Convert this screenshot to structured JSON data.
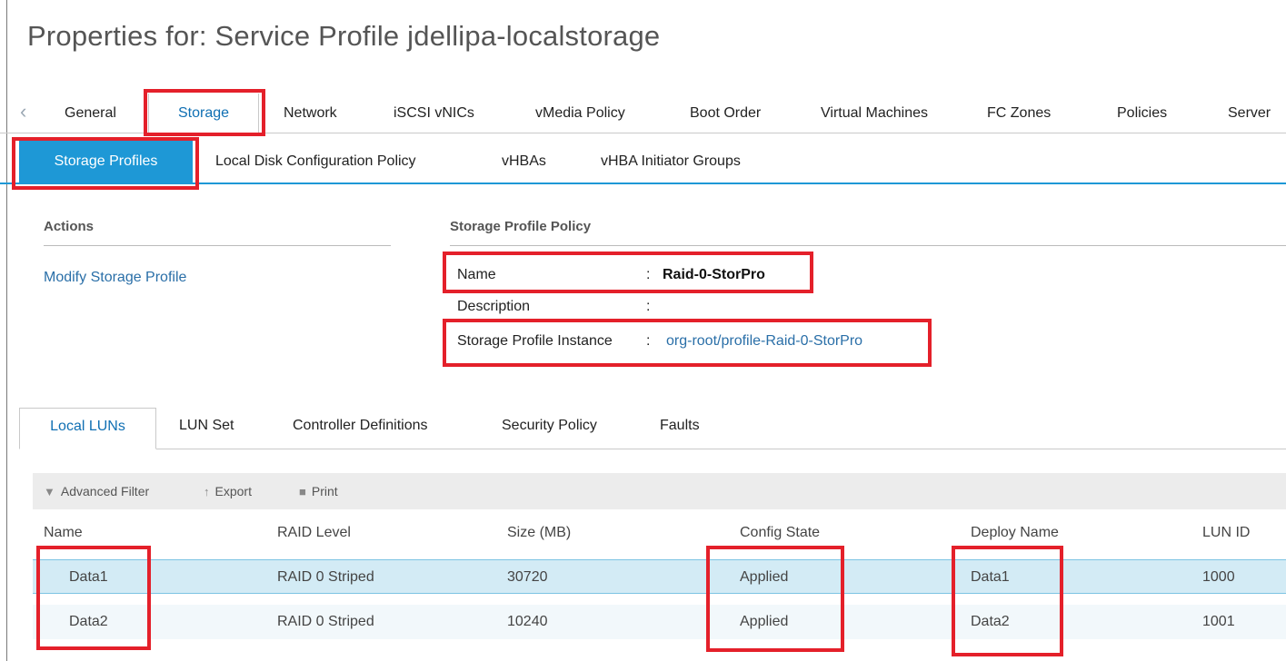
{
  "header": {
    "title": "Properties for: Service Profile jdellipa-localstorage"
  },
  "top_tabs": [
    "General",
    "Storage",
    "Network",
    "iSCSI vNICs",
    "vMedia Policy",
    "Boot Order",
    "Virtual Machines",
    "FC Zones",
    "Policies",
    "Server"
  ],
  "top_tab_scroll_glyph": "‹",
  "sub_tabs": [
    "Storage Profiles",
    "Local Disk Configuration Policy",
    "vHBAs",
    "vHBA Initiator Groups"
  ],
  "actions": {
    "heading": "Actions",
    "modify_link": "Modify Storage Profile"
  },
  "policy": {
    "heading": "Storage Profile Policy",
    "name_label": "Name",
    "name_value": "Raid-0-StorPro",
    "description_label": "Description",
    "description_value": "",
    "instance_label": "Storage Profile Instance",
    "instance_value": "org-root/profile-Raid-0-StorPro",
    "separator": ":"
  },
  "bottom_tabs": [
    "Local LUNs",
    "LUN Set",
    "Controller Definitions",
    "Security Policy",
    "Faults"
  ],
  "toolbar": {
    "filter": "Advanced Filter",
    "export": "Export",
    "print": "Print"
  },
  "table": {
    "columns": [
      "Name",
      "RAID Level",
      "Size (MB)",
      "Config State",
      "Deploy Name",
      "LUN ID"
    ],
    "rows": [
      [
        "Data1",
        "RAID 0 Striped",
        "30720",
        "Applied",
        "Data1",
        "1000"
      ],
      [
        "Data2",
        "RAID 0 Striped",
        "10240",
        "Applied",
        "Data2",
        "1001"
      ]
    ]
  },
  "colors": {
    "accent": "#1e98d6",
    "highlight": "#e4202a",
    "link": "#2a6fa8"
  }
}
